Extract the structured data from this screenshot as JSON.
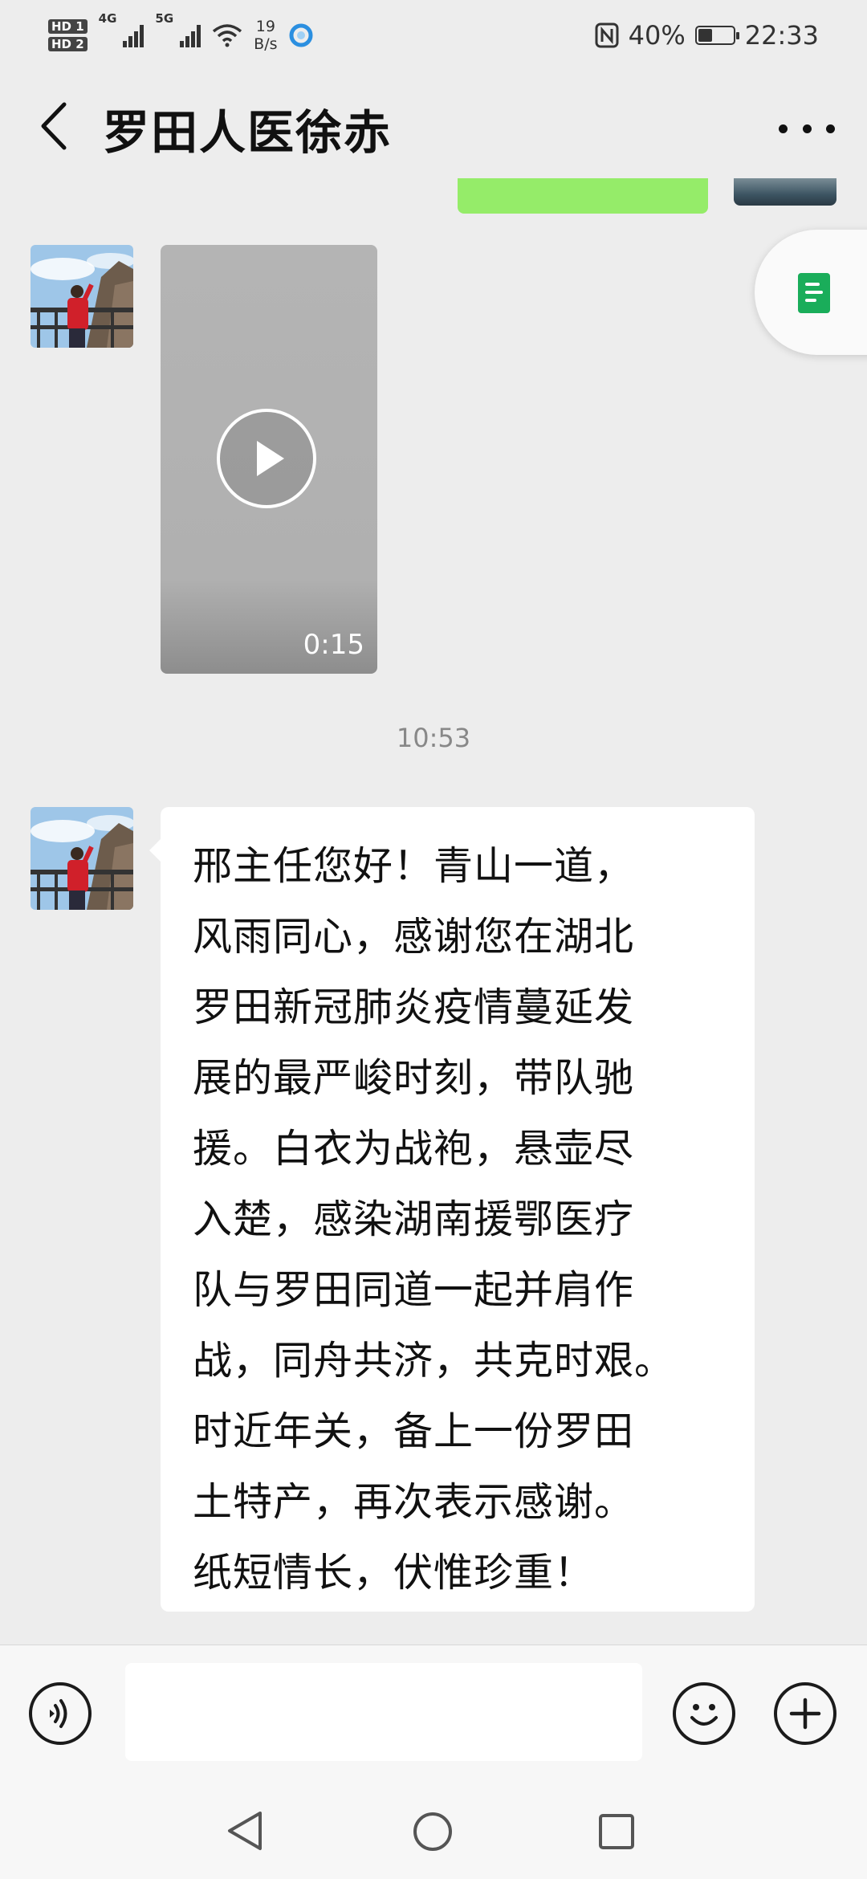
{
  "status_bar": {
    "hd1": "HD 1",
    "hd2": "HD 2",
    "net1": "4G",
    "net2": "5G",
    "speed_value": "19",
    "speed_unit": "B/s",
    "battery_text": "40%",
    "battery_level": 0.4,
    "time": "22:33"
  },
  "header": {
    "title": "罗田人医徐赤"
  },
  "messages": {
    "video_duration": "0:15",
    "timestamp": "10:53",
    "text_lines": [
      "邢主任您好！青山一道，",
      "风雨同心，感谢您在湖北",
      "罗田新冠肺炎疫情蔓延发",
      "展的最严峻时刻，带队驰",
      "援。白衣为战袍，悬壶尽",
      "入楚，感染湖南援鄂医疗",
      "队与罗田同道一起并肩作",
      "战，同舟共济，共克时艰。",
      "时近年关，备上一份罗田",
      "土特产，再次表示感谢。",
      "纸短情长，伏惟珍重！"
    ]
  },
  "colors": {
    "background": "#ededed",
    "my_bubble": "#95ec69",
    "their_bubble": "#ffffff",
    "accent_green": "#1aad5a"
  },
  "icons": {
    "back": "back-arrow-icon",
    "more": "more-icon",
    "play": "play-icon",
    "voice": "voice-icon",
    "emoji": "emoji-icon",
    "add": "add-icon",
    "doc": "document-icon"
  }
}
